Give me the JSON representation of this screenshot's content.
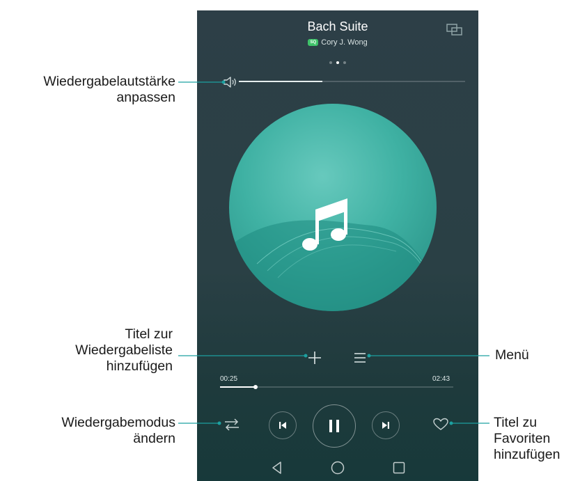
{
  "player": {
    "song_title": "Bach Suite",
    "quality_badge": "SQ",
    "artist": "Cory J. Wong",
    "page_dots": 3,
    "active_page": 1,
    "volume_level": 0.37,
    "elapsed_time": "00:25",
    "total_time": "02:43",
    "progress": 0.153,
    "state": "playing",
    "accent_color": "#1ca0a0",
    "art_color": "#3fb1a3",
    "icons": {
      "cast": "screen-projection-icon",
      "volume": "speaker-icon",
      "art": "music-note-icon",
      "add": "plus-icon",
      "menu": "menu-lines-icon",
      "mode": "shuffle-icon",
      "prev": "skip-previous-icon",
      "play": "pause-icon",
      "next": "skip-next-icon",
      "favorite": "heart-icon"
    }
  },
  "navbar": {
    "icons": [
      "back-triangle-icon",
      "home-circle-icon",
      "recents-square-icon"
    ]
  },
  "callouts": {
    "volume": [
      "Wiedergabelautstärke",
      "anpassen"
    ],
    "add_to_playlist": [
      "Titel zur",
      "Wiedergabeliste",
      "hinzufügen"
    ],
    "change_mode": [
      "Wiedergabemodus",
      "ändern"
    ],
    "menu": [
      "Menü"
    ],
    "favorite": [
      "Titel zu",
      "Favoriten",
      "hinzufügen"
    ]
  }
}
